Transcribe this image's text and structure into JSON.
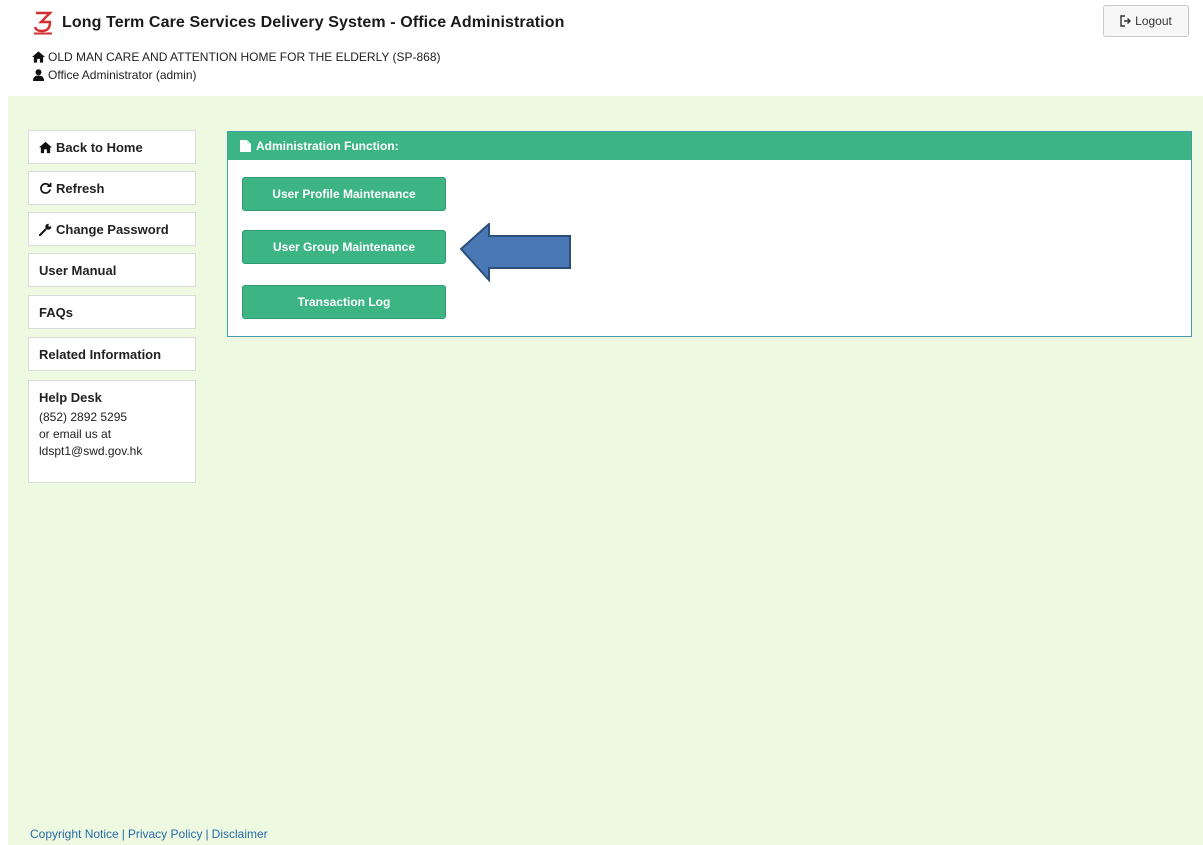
{
  "header": {
    "app_title": "Long Term Care Services Delivery System - Office Administration",
    "organization": "OLD MAN CARE AND ATTENTION HOME FOR THE ELDERLY (SP-868)",
    "user": "Office Administrator (admin)",
    "logout_label": "Logout"
  },
  "sidebar": {
    "items": [
      {
        "label": "Back to Home",
        "icon": "home-icon"
      },
      {
        "label": "Refresh",
        "icon": "refresh-icon"
      },
      {
        "label": "Change Password",
        "icon": "wrench-icon"
      },
      {
        "label": "User Manual"
      },
      {
        "label": "FAQs"
      },
      {
        "label": "Related Information"
      }
    ],
    "help_desk": {
      "title": "Help Desk",
      "phone": "(852) 2892 5295",
      "email_prompt": "or email us at",
      "email": "ldspt1@swd.gov.hk"
    }
  },
  "admin_panel": {
    "title": "Administration Function:",
    "buttons": [
      {
        "label": "User Profile Maintenance"
      },
      {
        "label": "User Group Maintenance"
      },
      {
        "label": "Transaction Log"
      }
    ]
  },
  "footer": {
    "copyright": "Copyright Notice",
    "privacy": "Privacy Policy",
    "disclaimer": "Disclaimer",
    "separator": "|"
  },
  "colors": {
    "brand_red": "#d32f2f",
    "accent_green": "#3cb483",
    "background_green": "#eef9e1",
    "arrow_blue": "#4a78b5",
    "link_blue": "#2a6aa8"
  }
}
